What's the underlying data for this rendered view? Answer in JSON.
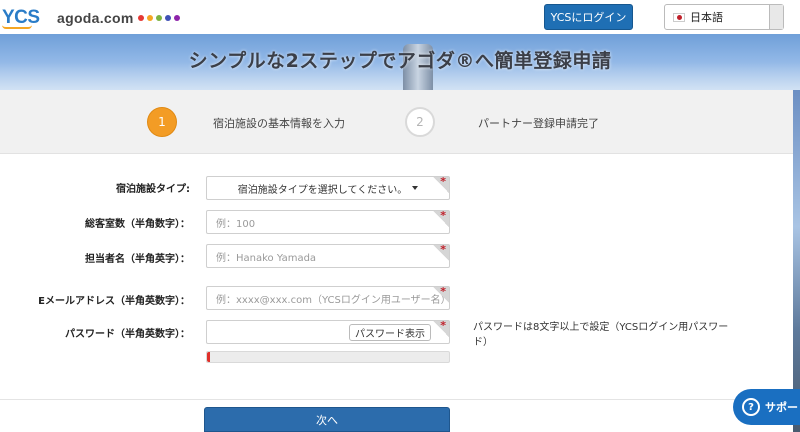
{
  "header": {
    "logo": "YCS",
    "brand": "agoda.com",
    "dot_colors": [
      "#e53935",
      "#f5a623",
      "#7cb342",
      "#3f51b5",
      "#8e24aa"
    ],
    "login_label": "YCSにログイン",
    "language": {
      "selected": "日本語",
      "flag_icon": "japan-flag-icon"
    }
  },
  "hero": {
    "title": "シンプルな2ステップでアゴダ®へ簡単登録申請"
  },
  "steps": [
    {
      "number": "1",
      "label": "宿泊施設の基本情報を入力",
      "active": true
    },
    {
      "number": "2",
      "label": "パートナー登録申請完了",
      "active": false
    }
  ],
  "form": {
    "property_type": {
      "label": "宿泊施設タイプ:",
      "value": "宿泊施設タイプを選択してください。"
    },
    "room_count": {
      "label": "総客室数（半角数字）：",
      "placeholder": "例：100"
    },
    "contact_name": {
      "label": "担当者名（半角英字）：",
      "placeholder": "例：Hanako Yamada"
    },
    "email": {
      "label": "Eメールアドレス（半角英数字）：",
      "placeholder": "例：xxxx@xxx.com（YCSログイン用ユーザー名）"
    },
    "password": {
      "label": "パスワード（半角英数字）：",
      "toggle_label": "パスワード表示",
      "hint": "パスワードは8文字以上で設定（YCSログイン用パスワード）",
      "strength": 0.01
    },
    "required_mark": "*"
  },
  "next_label": "次へ",
  "support": {
    "label": "サポー",
    "icon": "question-icon"
  }
}
